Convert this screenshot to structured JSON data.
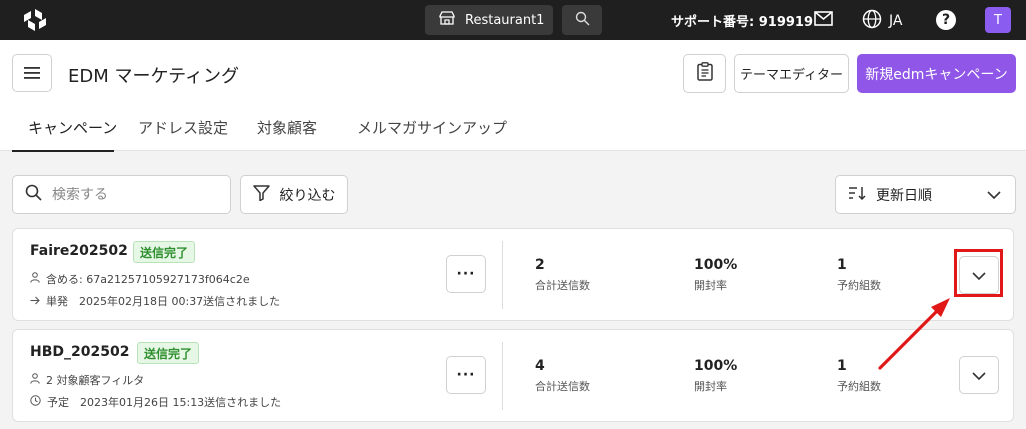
{
  "topbar": {
    "store_name": "Restaurant1",
    "support_text": "サポート番号: 919919",
    "language": "JA",
    "help_glyph": "?",
    "avatar_initial": "T",
    "avatar_color": "#8a5cf0"
  },
  "header": {
    "page_title": "EDM マーケティング",
    "theme_editor_label": "テーマエディター",
    "new_campaign_label": "新規edmキャンペーン",
    "accent_color": "#8f56e8"
  },
  "tabs": [
    {
      "label": "キャンペーン",
      "active": true
    },
    {
      "label": "アドレス設定",
      "active": false
    },
    {
      "label": "対象顧客",
      "active": false
    },
    {
      "label": "メルマガサインアップ",
      "active": false
    }
  ],
  "toolbar": {
    "search_placeholder": "検索する",
    "filter_label": "絞り込む",
    "sort_label": "更新日順"
  },
  "campaigns": [
    {
      "name": "Faire202502",
      "status": "送信完了",
      "audience": "含める: 67a21257105927173f064c2e",
      "schedule": "単発　2025年02月18日 00:37送信されました",
      "stats": [
        {
          "value": "2",
          "label": "合計送信数"
        },
        {
          "value": "100%",
          "label": "開封率"
        },
        {
          "value": "1",
          "label": "予約組数"
        }
      ],
      "more_glyph": "···"
    },
    {
      "name": "HBD_202502",
      "status": "送信完了",
      "audience": "2 対象顧客フィルタ",
      "schedule": "予定　2023年01月26日 15:13送信されました",
      "stats": [
        {
          "value": "4",
          "label": "合計送信数"
        },
        {
          "value": "100%",
          "label": "開封率"
        },
        {
          "value": "1",
          "label": "予約組数"
        }
      ],
      "more_glyph": "···"
    }
  ],
  "annotation_color": "#e01818"
}
